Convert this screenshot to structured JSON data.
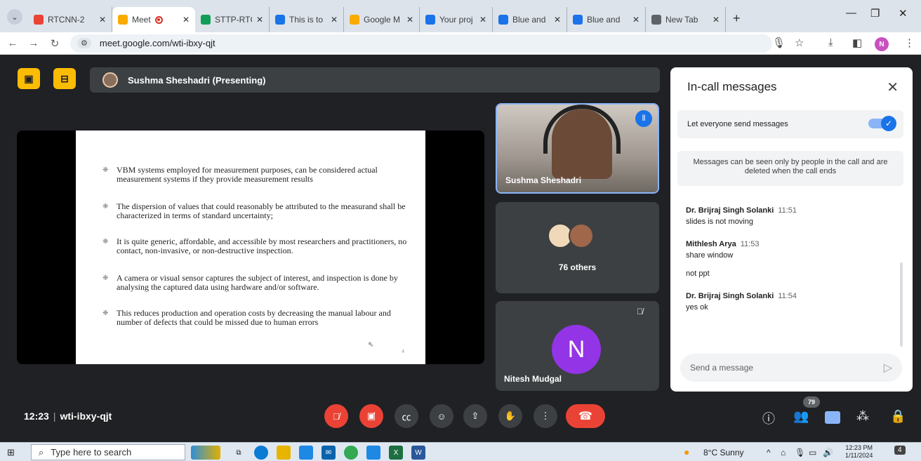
{
  "browser": {
    "tabs": [
      {
        "title": "RTCNN-2",
        "favicon": "gmail-icon",
        "color": "#ea4335",
        "active": false
      },
      {
        "title": "Meet",
        "favicon": "meet-icon",
        "color": "#f9ab00",
        "active": true,
        "recording": true
      },
      {
        "title": "STTP-RTC",
        "favicon": "drive-icon",
        "color": "#0f9d58",
        "active": false
      },
      {
        "title": "This is to",
        "favicon": "forms-icon",
        "color": "#1a73e8",
        "active": false
      },
      {
        "title": "Google M",
        "favicon": "meet-icon",
        "color": "#f9ab00",
        "active": false
      },
      {
        "title": "Your proj",
        "favicon": "project-icon",
        "color": "#1a73e8",
        "active": false
      },
      {
        "title": "Blue and",
        "favicon": "forms-icon",
        "color": "#1a73e8",
        "active": false
      },
      {
        "title": "Blue and",
        "favicon": "forms-icon",
        "color": "#1a73e8",
        "active": false
      },
      {
        "title": "New Tab",
        "favicon": "chrome-icon",
        "color": "#5f6368",
        "active": false
      }
    ],
    "new_tab": "+",
    "url": "meet.google.com/wti-ibxy-qjt",
    "profile_initial": "N"
  },
  "meet": {
    "presenter_banner": "Sushma Sheshadri (Presenting)",
    "slide": {
      "bullets": [
        "VBM systems employed for measurement purposes, can be considered actual measurement systems if they provide measurement results",
        "The dispersion of values that could reasonably be attributed to the measurand shall be characterized in terms of standard uncertainty;",
        "It is quite generic, affordable, and accessible by most researchers and practitioners,  no contact, non-invasive, or non-destructive inspection.",
        "A camera or visual sensor captures the subject of interest, and inspection is done by analysing the captured data using hardware and/or software.",
        "This reduces production and operation costs by decreasing the manual labour and number of defects that could be missed due to human errors"
      ],
      "page_number": "4"
    },
    "tiles": {
      "presenter_name": "Sushma Sheshadri",
      "others_label": "76 others",
      "participant_name": "Nitesh Mudgal",
      "participant_initial": "N"
    },
    "chat": {
      "title": "In-call messages",
      "toggle_label": "Let everyone send messages",
      "toggle_on": true,
      "info": "Messages can be seen only by people in the call and are deleted when the call ends",
      "messages": [
        {
          "sender": "Dr. Brijraj Singh Solanki",
          "time": "11:51",
          "lines": [
            "slides is not moving"
          ]
        },
        {
          "sender": "Mithlesh Arya",
          "time": "11:53",
          "lines": [
            "share window",
            "not ppt"
          ]
        },
        {
          "sender": "Dr. Brijraj Singh Solanki",
          "time": "11:54",
          "lines": [
            "yes ok"
          ]
        }
      ],
      "input_placeholder": "Send a message"
    },
    "bottom": {
      "time": "12:23",
      "meeting_code": "wti-ibxy-qjt",
      "participant_count": "79"
    }
  },
  "taskbar": {
    "search_placeholder": "Type here to search",
    "weather": "8°C  Sunny",
    "time": "12:23 PM",
    "date": "1/11/2024",
    "notification_count": "4"
  },
  "colors": {
    "meet_bg": "#202124",
    "accent_blue": "#1a73e8",
    "end_call_red": "#ea4335",
    "presenter_yellow": "#fbbc04",
    "avatar_purple": "#9334e6"
  }
}
